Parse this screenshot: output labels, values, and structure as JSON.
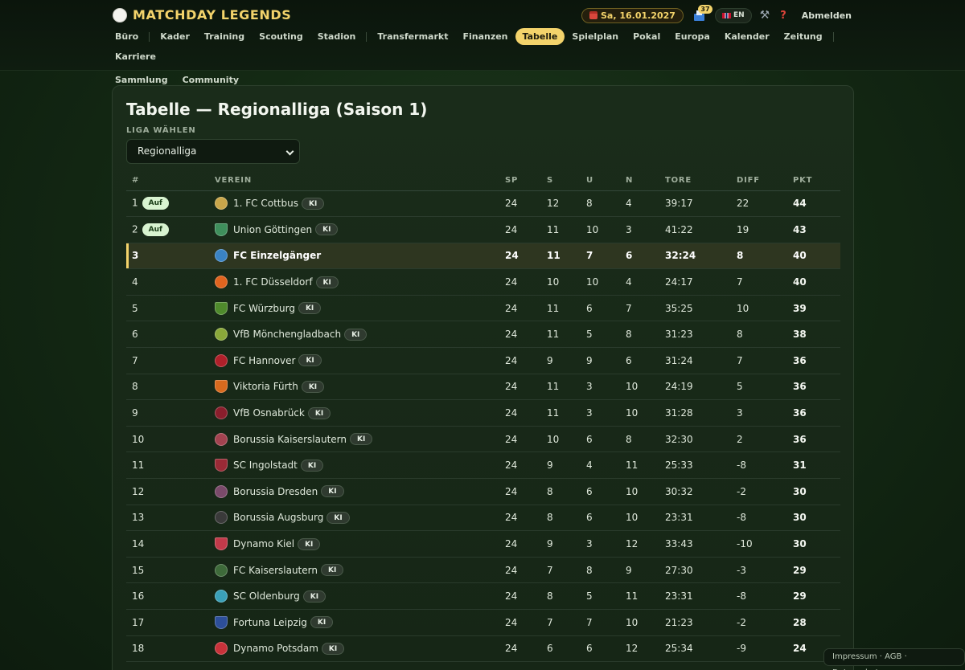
{
  "app": {
    "title": "MATCHDAY LEGENDS",
    "date": "Sa, 16.01.2027",
    "mail_count": "37",
    "language": "EN",
    "logout": "Abmelden"
  },
  "nav": {
    "items": [
      {
        "label": "Büro"
      },
      {
        "label": "Kader"
      },
      {
        "label": "Training"
      },
      {
        "label": "Scouting"
      },
      {
        "label": "Stadion"
      },
      {
        "label": "Transfermarkt"
      },
      {
        "label": "Finanzen"
      },
      {
        "label": "Tabelle",
        "active": true
      },
      {
        "label": "Spielplan"
      },
      {
        "label": "Pokal"
      },
      {
        "label": "Europa"
      },
      {
        "label": "Kalender"
      },
      {
        "label": "Zeitung"
      },
      {
        "label": "Karriere"
      },
      {
        "label": "Sammlung"
      },
      {
        "label": "Community"
      }
    ]
  },
  "page": {
    "title": "Tabelle — Regionalliga (Saison 1)",
    "league_label": "LIGA WÄHLEN",
    "league_selected": "Regionalliga"
  },
  "table": {
    "headers": [
      "#",
      "VEREIN",
      "SP",
      "S",
      "U",
      "N",
      "TORE",
      "DIFF",
      "PKT"
    ],
    "badge_promo": "Auf",
    "badge_ai": "KI",
    "rows": [
      {
        "rank": "1",
        "badge": "Auf",
        "club": "1. FC Cottbus",
        "ai": true,
        "sp": "24",
        "s": "12",
        "u": "8",
        "n": "4",
        "tore": "39:17",
        "diff": "22",
        "pkt": "44",
        "crest": "#c9a64a"
      },
      {
        "rank": "2",
        "badge": "Auf",
        "club": "Union Göttingen",
        "ai": true,
        "sp": "24",
        "s": "11",
        "u": "10",
        "n": "3",
        "tore": "41:22",
        "diff": "19",
        "pkt": "43",
        "crest": "#3f8f5c"
      },
      {
        "rank": "3",
        "badge": "",
        "club": "FC Einzelgänger",
        "ai": false,
        "mine": true,
        "sp": "24",
        "s": "11",
        "u": "7",
        "n": "6",
        "tore": "32:24",
        "diff": "8",
        "pkt": "40",
        "crest": "#3a83c4"
      },
      {
        "rank": "4",
        "badge": "",
        "club": "1. FC Düsseldorf",
        "ai": true,
        "sp": "24",
        "s": "10",
        "u": "10",
        "n": "4",
        "tore": "24:17",
        "diff": "7",
        "pkt": "40",
        "crest": "#e0641f"
      },
      {
        "rank": "5",
        "badge": "",
        "club": "FC Würzburg",
        "ai": true,
        "sp": "24",
        "s": "11",
        "u": "6",
        "n": "7",
        "tore": "35:25",
        "diff": "10",
        "pkt": "39",
        "crest": "#4f8a2c"
      },
      {
        "rank": "6",
        "badge": "",
        "club": "VfB Mönchengladbach",
        "ai": true,
        "sp": "24",
        "s": "11",
        "u": "5",
        "n": "8",
        "tore": "31:23",
        "diff": "8",
        "pkt": "38",
        "crest": "#8aa83a"
      },
      {
        "rank": "7",
        "badge": "",
        "club": "FC Hannover",
        "ai": true,
        "sp": "24",
        "s": "9",
        "u": "9",
        "n": "6",
        "tore": "31:24",
        "diff": "7",
        "pkt": "36",
        "crest": "#b0202a"
      },
      {
        "rank": "8",
        "badge": "",
        "club": "Viktoria Fürth",
        "ai": true,
        "sp": "24",
        "s": "11",
        "u": "3",
        "n": "10",
        "tore": "24:19",
        "diff": "5",
        "pkt": "36",
        "crest": "#d86a1e"
      },
      {
        "rank": "9",
        "badge": "",
        "club": "VfB Osnabrück",
        "ai": true,
        "sp": "24",
        "s": "11",
        "u": "3",
        "n": "10",
        "tore": "31:28",
        "diff": "3",
        "pkt": "36",
        "crest": "#8a1e2c"
      },
      {
        "rank": "10",
        "badge": "",
        "club": "Borussia Kaiserslautern",
        "ai": true,
        "sp": "24",
        "s": "10",
        "u": "6",
        "n": "8",
        "tore": "32:30",
        "diff": "2",
        "pkt": "36",
        "crest": "#a34350"
      },
      {
        "rank": "11",
        "badge": "",
        "club": "SC Ingolstadt",
        "ai": true,
        "sp": "24",
        "s": "9",
        "u": "4",
        "n": "11",
        "tore": "25:33",
        "diff": "-8",
        "pkt": "31",
        "crest": "#9a2a36"
      },
      {
        "rank": "12",
        "badge": "",
        "club": "Borussia Dresden",
        "ai": true,
        "sp": "24",
        "s": "8",
        "u": "6",
        "n": "10",
        "tore": "30:32",
        "diff": "-2",
        "pkt": "30",
        "crest": "#7a4a6a"
      },
      {
        "rank": "13",
        "badge": "",
        "club": "Borussia Augsburg",
        "ai": true,
        "sp": "24",
        "s": "8",
        "u": "6",
        "n": "10",
        "tore": "23:31",
        "diff": "-8",
        "pkt": "30",
        "crest": "#3a3a3a"
      },
      {
        "rank": "14",
        "badge": "",
        "club": "Dynamo Kiel",
        "ai": true,
        "sp": "24",
        "s": "9",
        "u": "3",
        "n": "12",
        "tore": "33:43",
        "diff": "-10",
        "pkt": "30",
        "crest": "#c23a4a"
      },
      {
        "rank": "15",
        "badge": "",
        "club": "FC Kaiserslautern",
        "ai": true,
        "sp": "24",
        "s": "7",
        "u": "8",
        "n": "9",
        "tore": "27:30",
        "diff": "-3",
        "pkt": "29",
        "crest": "#3e6a3a"
      },
      {
        "rank": "16",
        "badge": "",
        "club": "SC Oldenburg",
        "ai": true,
        "sp": "24",
        "s": "8",
        "u": "5",
        "n": "11",
        "tore": "23:31",
        "diff": "-8",
        "pkt": "29",
        "crest": "#3aa0b8"
      },
      {
        "rank": "17",
        "badge": "",
        "club": "Fortuna Leipzig",
        "ai": true,
        "sp": "24",
        "s": "7",
        "u": "7",
        "n": "10",
        "tore": "21:23",
        "diff": "-2",
        "pkt": "28",
        "crest": "#2d4f9a"
      },
      {
        "rank": "18",
        "badge": "",
        "club": "Dynamo Potsdam",
        "ai": true,
        "sp": "24",
        "s": "6",
        "u": "6",
        "n": "12",
        "tore": "25:34",
        "diff": "-9",
        "pkt": "24",
        "crest": "#c8323a"
      }
    ]
  },
  "footer": {
    "links": "Impressum · AGB · Datenschutz"
  }
}
